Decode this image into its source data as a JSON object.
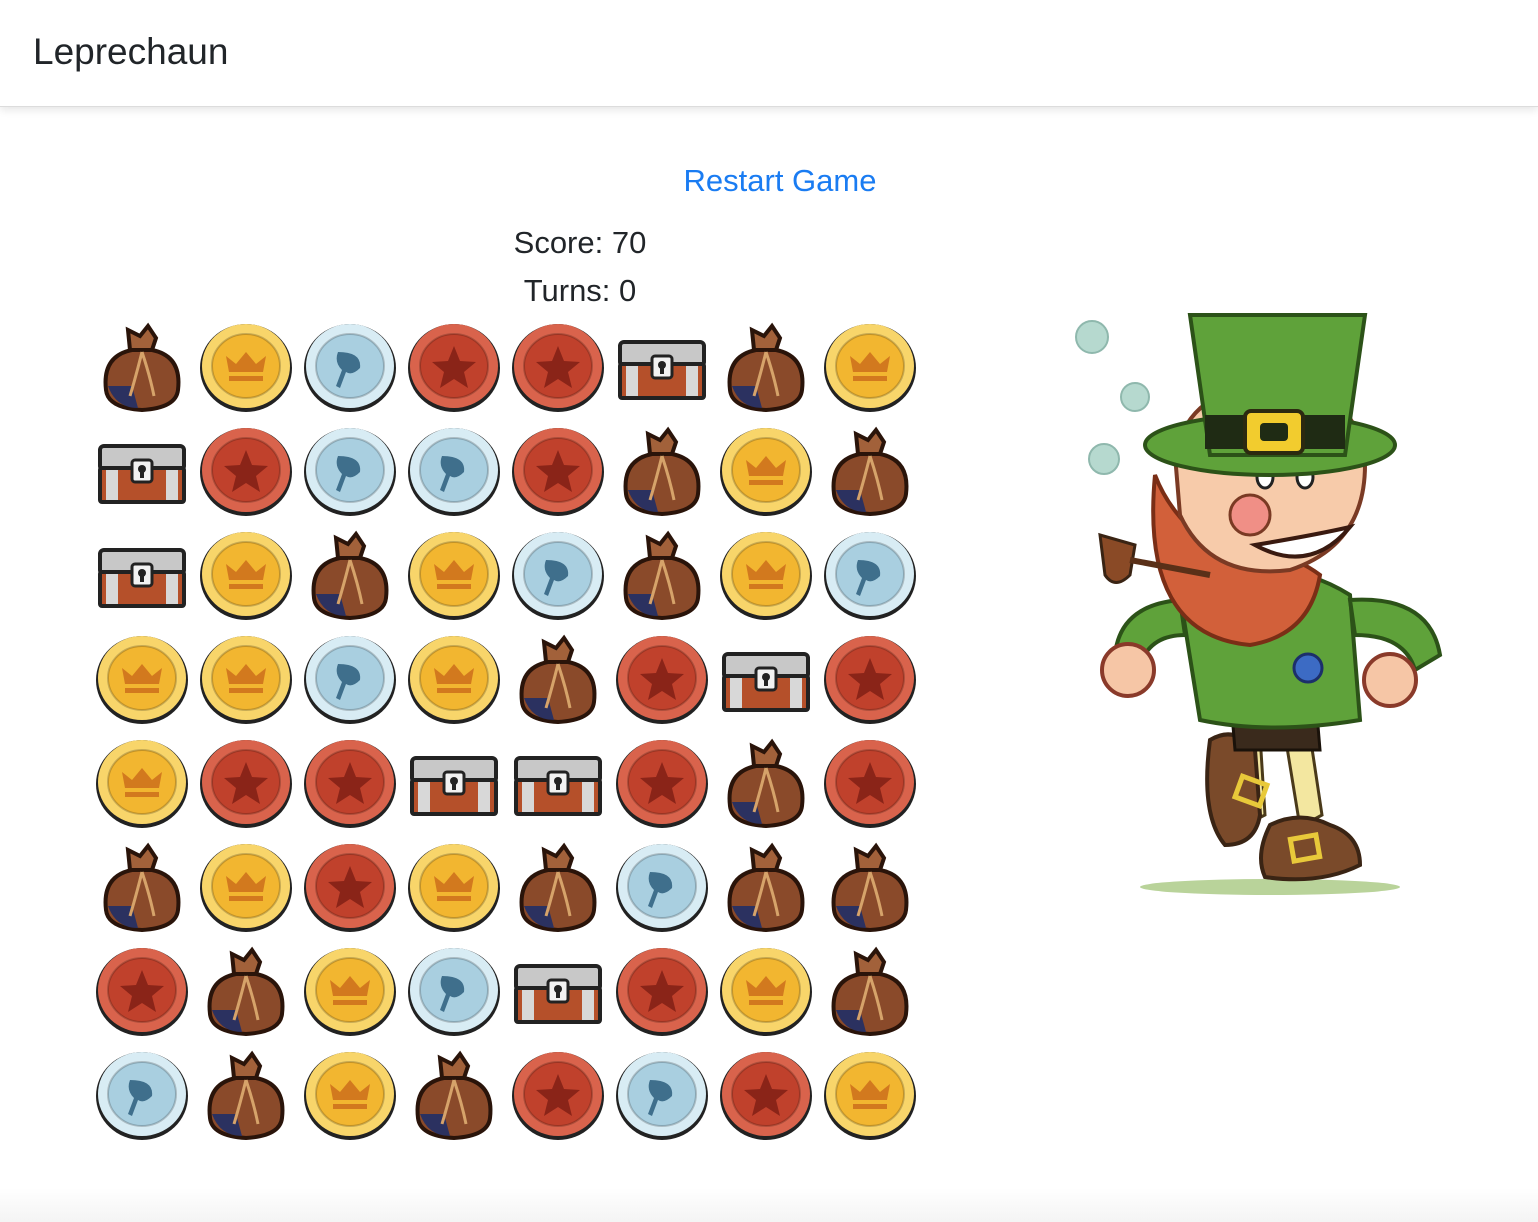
{
  "navbar": {
    "brand": "Leprechaun"
  },
  "controls": {
    "restart_label": "Restart Game"
  },
  "stats": {
    "score": "Score: 70",
    "turns": "Turns: 0"
  },
  "board": {
    "rows": 8,
    "cols": 8,
    "grid": [
      [
        "bag",
        "gold-coin",
        "silver-coin",
        "red-coin",
        "red-coin",
        "chest",
        "bag",
        "gold-coin"
      ],
      [
        "chest",
        "red-coin",
        "silver-coin",
        "silver-coin",
        "red-coin",
        "bag",
        "gold-coin",
        "bag"
      ],
      [
        "chest",
        "gold-coin",
        "bag",
        "gold-coin",
        "silver-coin",
        "bag",
        "gold-coin",
        "silver-coin"
      ],
      [
        "gold-coin",
        "gold-coin",
        "silver-coin",
        "gold-coin",
        "bag",
        "red-coin",
        "chest",
        "red-coin"
      ],
      [
        "gold-coin",
        "red-coin",
        "red-coin",
        "chest",
        "chest",
        "red-coin",
        "bag",
        "red-coin"
      ],
      [
        "bag",
        "gold-coin",
        "red-coin",
        "gold-coin",
        "bag",
        "silver-coin",
        "bag",
        "bag"
      ],
      [
        "red-coin",
        "bag",
        "gold-coin",
        "silver-coin",
        "chest",
        "red-coin",
        "gold-coin",
        "bag"
      ],
      [
        "silver-coin",
        "bag",
        "gold-coin",
        "bag",
        "red-coin",
        "silver-coin",
        "red-coin",
        "gold-coin"
      ]
    ]
  },
  "colors": {
    "link": "#1a7cf2",
    "gold": "#f2b630",
    "silver": "#a9cfe0",
    "red": "#c0412c",
    "bag": "#8a4a2a",
    "chest": "#b5502a",
    "leprechaun_hat": "#5a9e36"
  }
}
